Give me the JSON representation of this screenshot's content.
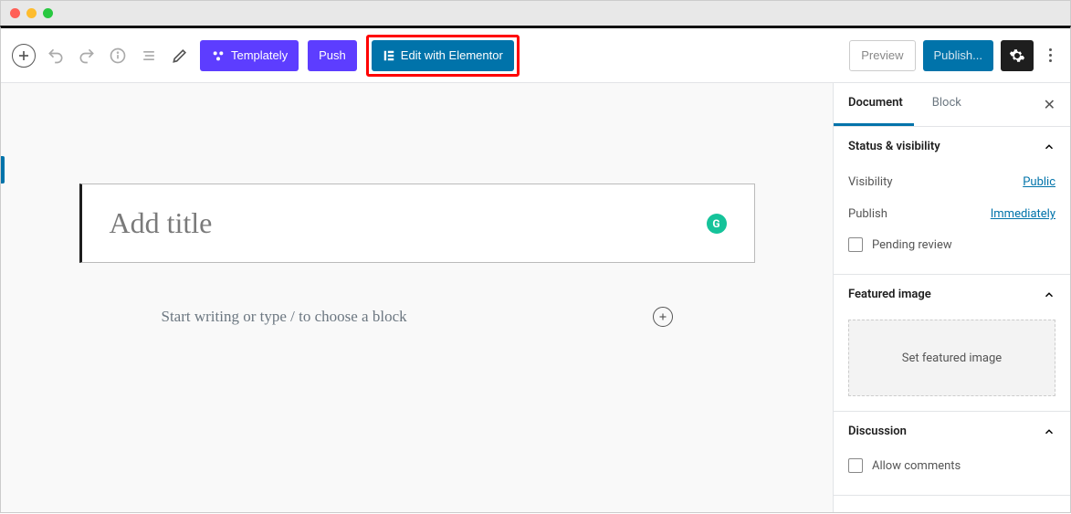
{
  "toolbar": {
    "templately_label": "Templately",
    "push_label": "Push",
    "elementor_label": "Edit with Elementor",
    "preview_label": "Preview",
    "publish_label": "Publish..."
  },
  "editor": {
    "title_placeholder": "Add title",
    "content_hint": "Start writing or type / to choose a block",
    "grammarly_badge": "G"
  },
  "sidebar": {
    "tabs": {
      "document": "Document",
      "block": "Block"
    },
    "panels": {
      "status": {
        "title": "Status & visibility",
        "visibility_label": "Visibility",
        "visibility_value": "Public",
        "publish_label": "Publish",
        "publish_value": "Immediately",
        "pending_review": "Pending review"
      },
      "featured": {
        "title": "Featured image",
        "dropzone": "Set featured image"
      },
      "discussion": {
        "title": "Discussion",
        "allow_comments": "Allow comments"
      }
    }
  }
}
